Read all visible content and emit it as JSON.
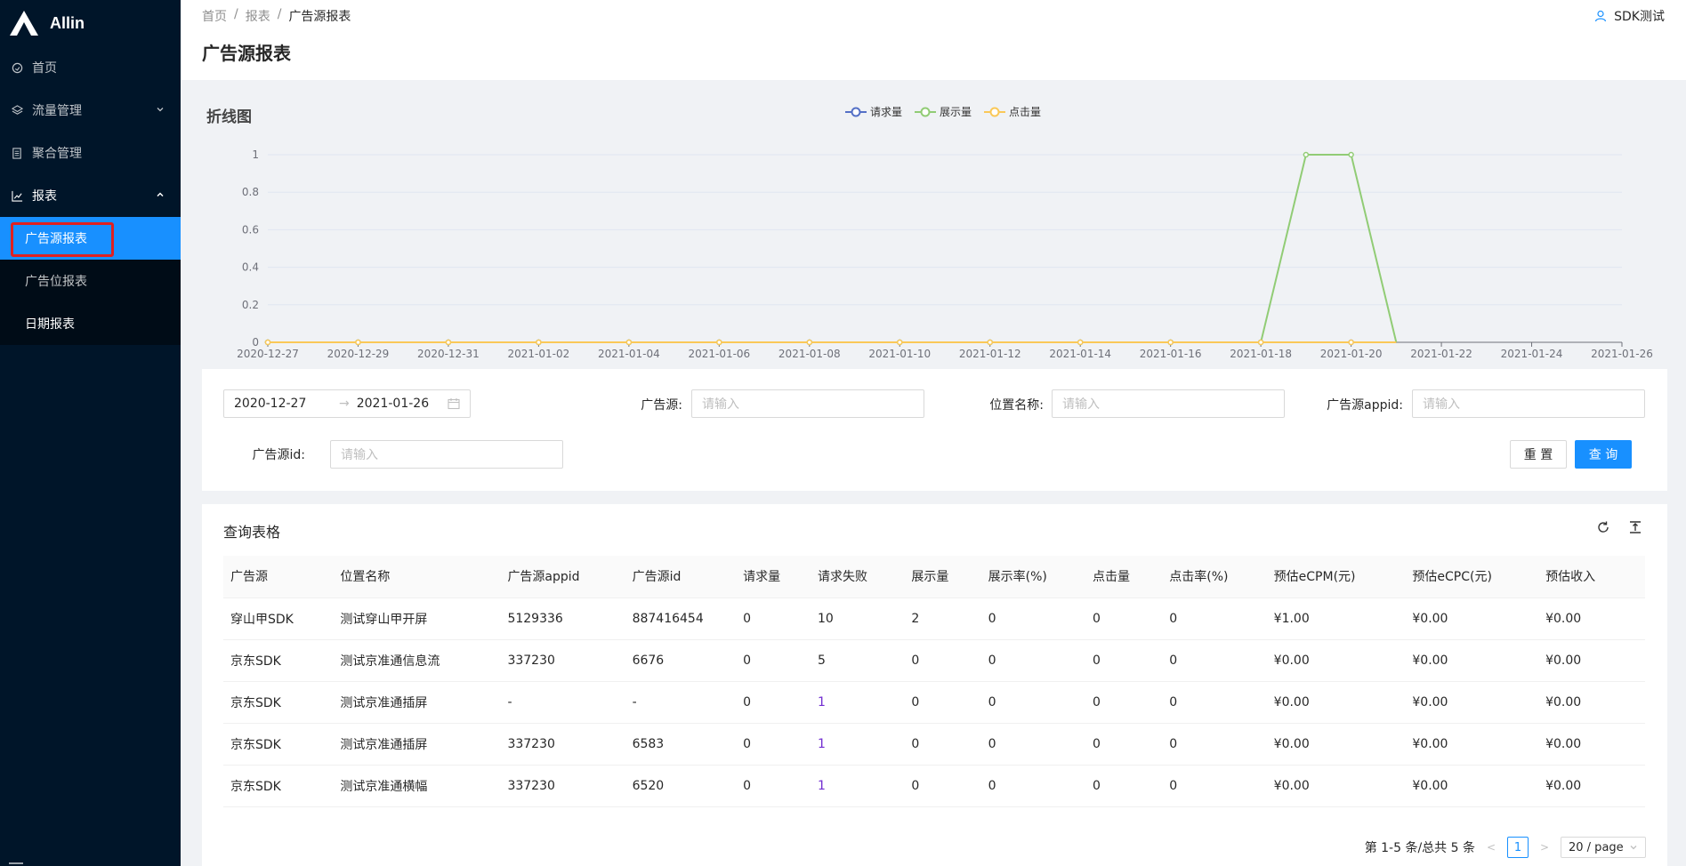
{
  "app": {
    "name": "Allin"
  },
  "sidebar": {
    "items": [
      {
        "label": "首页",
        "icon": "dashboard-icon"
      },
      {
        "label": "流量管理",
        "icon": "flow-icon"
      },
      {
        "label": "聚合管理",
        "icon": "list-icon"
      },
      {
        "label": "报表",
        "icon": "line-chart-icon"
      }
    ],
    "report_sub": [
      {
        "label": "广告源报表"
      },
      {
        "label": "广告位报表"
      },
      {
        "label": "日期报表"
      }
    ]
  },
  "header": {
    "breadcrumb": [
      "首页",
      "报表",
      "广告源报表"
    ],
    "separator": "/",
    "title": "广告源报表",
    "user": "SDK测试"
  },
  "chart_section": {
    "title": "折线图"
  },
  "chart_data": {
    "type": "line",
    "title": "",
    "xlabel": "",
    "ylabel": "",
    "ylim": [
      0,
      1
    ],
    "yticks": [
      "0",
      "0.2",
      "0.4",
      "0.6",
      "0.8",
      "1"
    ],
    "x": [
      "2020-12-27",
      "2020-12-28",
      "2020-12-29",
      "2020-12-30",
      "2020-12-31",
      "2021-01-01",
      "2021-01-02",
      "2021-01-03",
      "2021-01-04",
      "2021-01-05",
      "2021-01-06",
      "2021-01-07",
      "2021-01-08",
      "2021-01-09",
      "2021-01-10",
      "2021-01-11",
      "2021-01-12",
      "2021-01-13",
      "2021-01-14",
      "2021-01-15",
      "2021-01-16",
      "2021-01-17",
      "2021-01-18",
      "2021-01-19",
      "2021-01-20",
      "2021-01-21",
      "2021-01-22",
      "2021-01-23",
      "2021-01-24",
      "2021-01-25",
      "2021-01-26"
    ],
    "xtick_labels": [
      "2020-12-27",
      "2020-12-29",
      "2020-12-31",
      "2021-01-02",
      "2021-01-04",
      "2021-01-06",
      "2021-01-08",
      "2021-01-10",
      "2021-01-12",
      "2021-01-14",
      "2021-01-16",
      "2021-01-18",
      "2021-01-20",
      "2021-01-22",
      "2021-01-24",
      "2021-01-26"
    ],
    "series": [
      {
        "name": "请求量",
        "color": "#5470c6",
        "values": [
          0,
          0,
          0,
          0,
          0,
          0,
          0,
          0,
          0,
          0,
          0,
          0,
          0,
          0,
          0,
          0,
          0,
          0,
          0,
          0,
          0,
          0,
          0,
          0,
          0,
          0,
          0,
          0,
          0,
          0,
          0
        ]
      },
      {
        "name": "展示量",
        "color": "#91cc75",
        "values": [
          0,
          0,
          0,
          0,
          0,
          0,
          0,
          0,
          0,
          0,
          0,
          0,
          0,
          0,
          0,
          0,
          0,
          0,
          0,
          0,
          0,
          0,
          0,
          1,
          1,
          0,
          0,
          0,
          0,
          0,
          0
        ]
      },
      {
        "name": "点击量",
        "color": "#fac858",
        "values": [
          0,
          0,
          0,
          0,
          0,
          0,
          0,
          0,
          0,
          0,
          0,
          0,
          0,
          0,
          0,
          0,
          0,
          0,
          0,
          0,
          0,
          0,
          0,
          0,
          0,
          0,
          0,
          0,
          0,
          0,
          0
        ]
      }
    ],
    "legend": "top-center",
    "grid": true
  },
  "form": {
    "date_start": "2020-12-27",
    "date_end": "2021-01-26",
    "source_label": "广告源:",
    "position_label": "位置名称:",
    "appid_label": "广告源appid:",
    "id_label": "广告源id:",
    "placeholder": "请输入",
    "reset": "重 置",
    "query": "查 询"
  },
  "table": {
    "title": "查询表格",
    "columns": [
      "广告源",
      "位置名称",
      "广告源appid",
      "广告源id",
      "请求量",
      "请求失败",
      "展示量",
      "展示率(%)",
      "点击量",
      "点击率(%)",
      "预估eCPM(元)",
      "预估eCPC(元)",
      "预估收入"
    ],
    "rows": [
      [
        "穿山甲SDK",
        "测试穿山甲开屏",
        "5129336",
        "887416454",
        "0",
        "10",
        "2",
        "0",
        "0",
        "0",
        "¥1.00",
        "¥0.00",
        "¥0.00"
      ],
      [
        "京东SDK",
        "测试京准通信息流",
        "337230",
        "6676",
        "0",
        "5",
        "0",
        "0",
        "0",
        "0",
        "¥0.00",
        "¥0.00",
        "¥0.00"
      ],
      [
        "京东SDK",
        "测试京准通插屏",
        "-",
        "-",
        "0",
        "1",
        "0",
        "0",
        "0",
        "0",
        "¥0.00",
        "¥0.00",
        "¥0.00"
      ],
      [
        "京东SDK",
        "测试京准通插屏",
        "337230",
        "6583",
        "0",
        "1",
        "0",
        "0",
        "0",
        "0",
        "¥0.00",
        "¥0.00",
        "¥0.00"
      ],
      [
        "京东SDK",
        "测试京准通横幅",
        "337230",
        "6520",
        "0",
        "1",
        "0",
        "0",
        "0",
        "0",
        "¥0.00",
        "¥0.00",
        "¥0.00"
      ]
    ],
    "pagination": {
      "summary": "第 1-5 条/总共 5 条",
      "current": "1",
      "page_size": "20 / page"
    }
  }
}
